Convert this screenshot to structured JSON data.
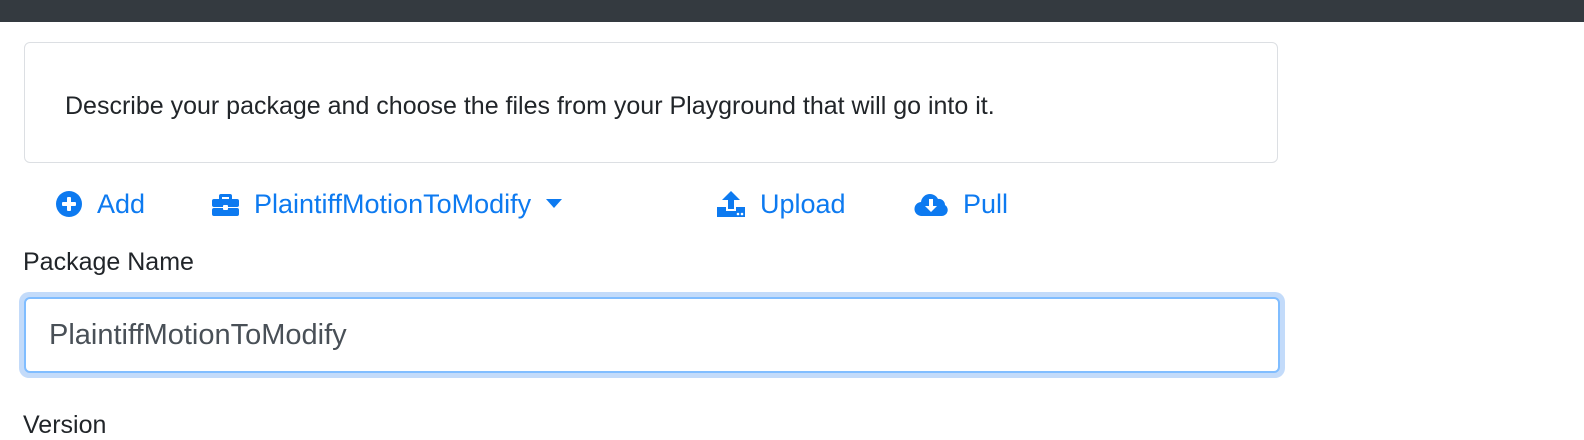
{
  "info": {
    "text": "Describe your package and choose the files from your Playground that will go into it."
  },
  "toolbar": {
    "add_label": "Add",
    "package_label": "PlaintiffMotionToModify",
    "upload_label": "Upload",
    "pull_label": "Pull",
    "accent_color": "#0d7af0",
    "icons": {
      "add": "plus-circle-icon",
      "package": "briefcase-icon",
      "dropdown": "caret-down-icon",
      "upload": "upload-icon",
      "pull": "cloud-download-icon"
    }
  },
  "form": {
    "package_name_label": "Package Name",
    "package_name_value": "PlaintiffMotionToModify",
    "version_label": "Version"
  },
  "colors": {
    "topbar": "#343a40",
    "input_focus": "#80bdff"
  }
}
